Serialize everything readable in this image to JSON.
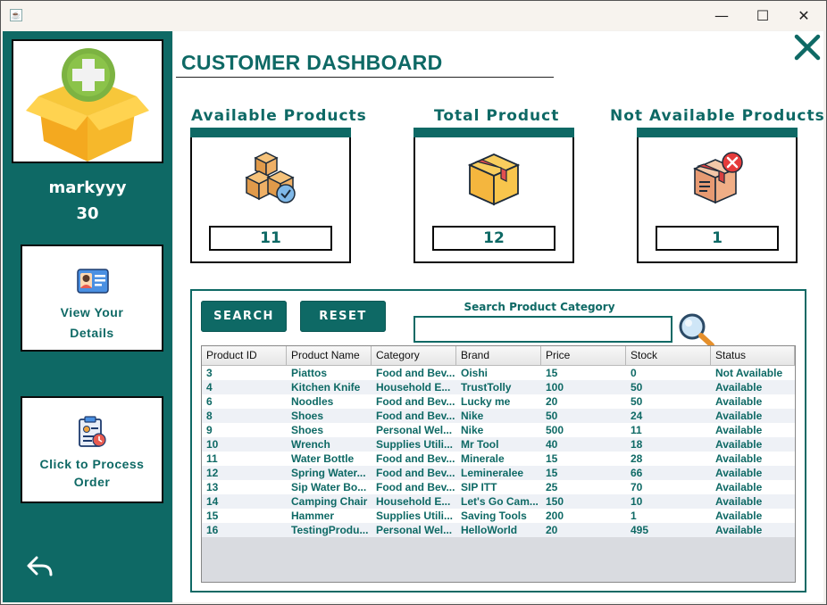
{
  "window": {
    "minimize_glyph": "—",
    "maximize_glyph": "☐",
    "close_glyph": "✕",
    "app_icon": "java-cup-icon"
  },
  "sidebar": {
    "avatar_icon": "box-add-icon",
    "username": "markyyy",
    "age": "30",
    "view_details": {
      "line1": "View Your",
      "line2": "Details",
      "icon": "id-card-icon"
    },
    "process_order": {
      "line1": "Click to Process",
      "line2": "Order",
      "icon": "clipboard-icon"
    },
    "back_icon": "back-arrow-icon"
  },
  "header": {
    "title": "CUSTOMER DASHBOARD",
    "close_icon": "close-x-icon"
  },
  "stats": [
    {
      "title": "Available Products",
      "value": "11",
      "icon": "boxes-check-icon"
    },
    {
      "title": "Total Product",
      "value": "12",
      "icon": "box-icon"
    },
    {
      "title": "Not Available Products",
      "value": "1",
      "icon": "box-x-icon"
    }
  ],
  "search": {
    "search_button": "SEARCH",
    "reset_button": "RESET",
    "label": "Search Product Category",
    "value": "",
    "placeholder": ""
  },
  "table": {
    "columns": [
      "Product ID",
      "Product Name",
      "Category",
      "Brand",
      "Price",
      "Stock",
      "Status"
    ],
    "rows": [
      [
        "3",
        "Piattos",
        "Food and Bev...",
        "Oishi",
        "15",
        "0",
        "Not Available"
      ],
      [
        "4",
        "Kitchen Knife",
        "Household E...",
        "TrustTolly",
        "100",
        "50",
        "Available"
      ],
      [
        "6",
        "Noodles",
        "Food and Bev...",
        "Lucky me",
        "20",
        "50",
        "Available"
      ],
      [
        "8",
        "Shoes",
        "Food and Bev...",
        "Nike",
        "50",
        "24",
        "Available"
      ],
      [
        "9",
        "Shoes",
        "Personal Wel...",
        "Nike",
        "500",
        "11",
        "Available"
      ],
      [
        "10",
        "Wrench",
        " Supplies Utili...",
        "Mr Tool",
        "40",
        "18",
        "Available"
      ],
      [
        "11",
        "Water Bottle",
        "Food and Bev...",
        "Minerale",
        "15",
        "28",
        "Available"
      ],
      [
        "12",
        "Spring Water...",
        "Food and Bev...",
        "Lemineralee",
        "15",
        "66",
        "Available"
      ],
      [
        "13",
        "Sip Water Bo...",
        "Food and Bev...",
        "SIP ITT",
        "25",
        "70",
        "Available"
      ],
      [
        "14",
        "Camping Chair",
        "Household E...",
        "Let's Go Cam...",
        "150",
        "10",
        "Available"
      ],
      [
        "15",
        "Hammer",
        " Supplies Utili...",
        " Saving Tools",
        "200",
        "1",
        "Available"
      ],
      [
        "16",
        "TestingProdu...",
        "Personal Wel...",
        "HelloWorld",
        "20",
        "495",
        "Available"
      ]
    ]
  },
  "colors": {
    "teal": "#0e6965",
    "row_alt": "#eef1f6",
    "white": "#ffffff"
  }
}
